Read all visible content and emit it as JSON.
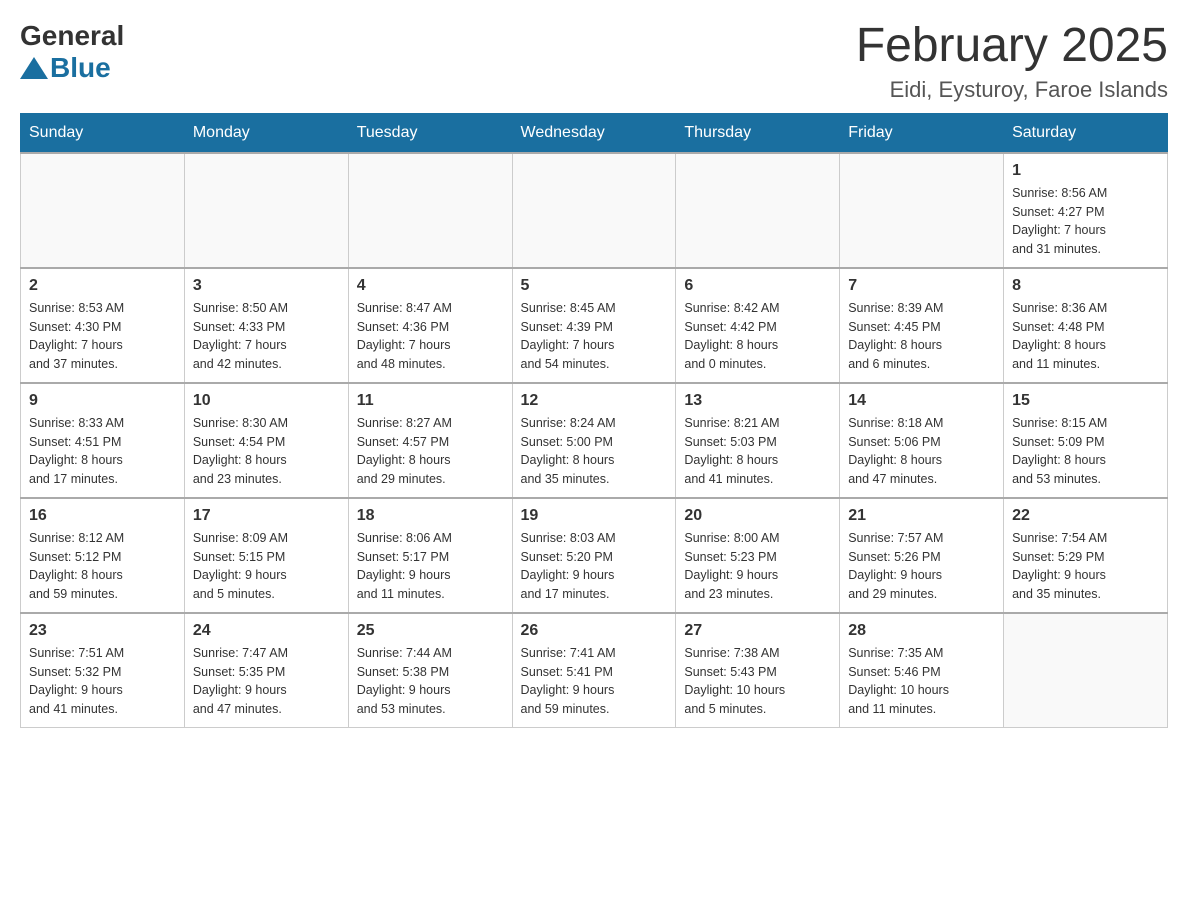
{
  "logo": {
    "general": "General",
    "blue": "Blue"
  },
  "title": "February 2025",
  "location": "Eidi, Eysturoy, Faroe Islands",
  "days_of_week": [
    "Sunday",
    "Monday",
    "Tuesday",
    "Wednesday",
    "Thursday",
    "Friday",
    "Saturday"
  ],
  "weeks": [
    [
      {
        "day": "",
        "info": ""
      },
      {
        "day": "",
        "info": ""
      },
      {
        "day": "",
        "info": ""
      },
      {
        "day": "",
        "info": ""
      },
      {
        "day": "",
        "info": ""
      },
      {
        "day": "",
        "info": ""
      },
      {
        "day": "1",
        "info": "Sunrise: 8:56 AM\nSunset: 4:27 PM\nDaylight: 7 hours\nand 31 minutes."
      }
    ],
    [
      {
        "day": "2",
        "info": "Sunrise: 8:53 AM\nSunset: 4:30 PM\nDaylight: 7 hours\nand 37 minutes."
      },
      {
        "day": "3",
        "info": "Sunrise: 8:50 AM\nSunset: 4:33 PM\nDaylight: 7 hours\nand 42 minutes."
      },
      {
        "day": "4",
        "info": "Sunrise: 8:47 AM\nSunset: 4:36 PM\nDaylight: 7 hours\nand 48 minutes."
      },
      {
        "day": "5",
        "info": "Sunrise: 8:45 AM\nSunset: 4:39 PM\nDaylight: 7 hours\nand 54 minutes."
      },
      {
        "day": "6",
        "info": "Sunrise: 8:42 AM\nSunset: 4:42 PM\nDaylight: 8 hours\nand 0 minutes."
      },
      {
        "day": "7",
        "info": "Sunrise: 8:39 AM\nSunset: 4:45 PM\nDaylight: 8 hours\nand 6 minutes."
      },
      {
        "day": "8",
        "info": "Sunrise: 8:36 AM\nSunset: 4:48 PM\nDaylight: 8 hours\nand 11 minutes."
      }
    ],
    [
      {
        "day": "9",
        "info": "Sunrise: 8:33 AM\nSunset: 4:51 PM\nDaylight: 8 hours\nand 17 minutes."
      },
      {
        "day": "10",
        "info": "Sunrise: 8:30 AM\nSunset: 4:54 PM\nDaylight: 8 hours\nand 23 minutes."
      },
      {
        "day": "11",
        "info": "Sunrise: 8:27 AM\nSunset: 4:57 PM\nDaylight: 8 hours\nand 29 minutes."
      },
      {
        "day": "12",
        "info": "Sunrise: 8:24 AM\nSunset: 5:00 PM\nDaylight: 8 hours\nand 35 minutes."
      },
      {
        "day": "13",
        "info": "Sunrise: 8:21 AM\nSunset: 5:03 PM\nDaylight: 8 hours\nand 41 minutes."
      },
      {
        "day": "14",
        "info": "Sunrise: 8:18 AM\nSunset: 5:06 PM\nDaylight: 8 hours\nand 47 minutes."
      },
      {
        "day": "15",
        "info": "Sunrise: 8:15 AM\nSunset: 5:09 PM\nDaylight: 8 hours\nand 53 minutes."
      }
    ],
    [
      {
        "day": "16",
        "info": "Sunrise: 8:12 AM\nSunset: 5:12 PM\nDaylight: 8 hours\nand 59 minutes."
      },
      {
        "day": "17",
        "info": "Sunrise: 8:09 AM\nSunset: 5:15 PM\nDaylight: 9 hours\nand 5 minutes."
      },
      {
        "day": "18",
        "info": "Sunrise: 8:06 AM\nSunset: 5:17 PM\nDaylight: 9 hours\nand 11 minutes."
      },
      {
        "day": "19",
        "info": "Sunrise: 8:03 AM\nSunset: 5:20 PM\nDaylight: 9 hours\nand 17 minutes."
      },
      {
        "day": "20",
        "info": "Sunrise: 8:00 AM\nSunset: 5:23 PM\nDaylight: 9 hours\nand 23 minutes."
      },
      {
        "day": "21",
        "info": "Sunrise: 7:57 AM\nSunset: 5:26 PM\nDaylight: 9 hours\nand 29 minutes."
      },
      {
        "day": "22",
        "info": "Sunrise: 7:54 AM\nSunset: 5:29 PM\nDaylight: 9 hours\nand 35 minutes."
      }
    ],
    [
      {
        "day": "23",
        "info": "Sunrise: 7:51 AM\nSunset: 5:32 PM\nDaylight: 9 hours\nand 41 minutes."
      },
      {
        "day": "24",
        "info": "Sunrise: 7:47 AM\nSunset: 5:35 PM\nDaylight: 9 hours\nand 47 minutes."
      },
      {
        "day": "25",
        "info": "Sunrise: 7:44 AM\nSunset: 5:38 PM\nDaylight: 9 hours\nand 53 minutes."
      },
      {
        "day": "26",
        "info": "Sunrise: 7:41 AM\nSunset: 5:41 PM\nDaylight: 9 hours\nand 59 minutes."
      },
      {
        "day": "27",
        "info": "Sunrise: 7:38 AM\nSunset: 5:43 PM\nDaylight: 10 hours\nand 5 minutes."
      },
      {
        "day": "28",
        "info": "Sunrise: 7:35 AM\nSunset: 5:46 PM\nDaylight: 10 hours\nand 11 minutes."
      },
      {
        "day": "",
        "info": ""
      }
    ]
  ]
}
